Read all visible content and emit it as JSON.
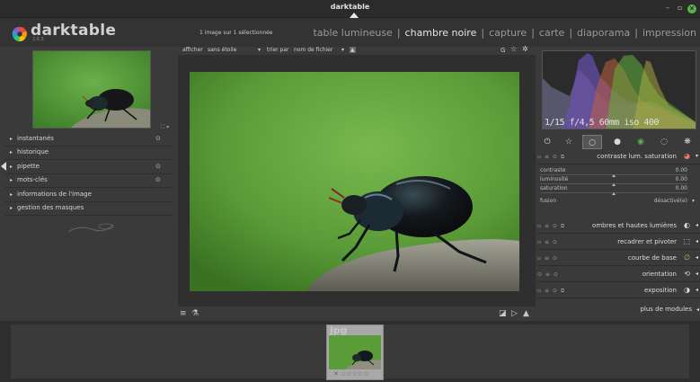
{
  "window": {
    "title": "darktable",
    "minimize": "–",
    "maximize": "▫",
    "close": "✕"
  },
  "header": {
    "app_name": "darktable",
    "version": "2.6.3",
    "selection_count": "1 image sur 1 sélectionnée",
    "views": [
      {
        "label": "table lumineuse",
        "active": false
      },
      {
        "label": "chambre noire",
        "active": true
      },
      {
        "label": "capture",
        "active": false
      },
      {
        "label": "carte",
        "active": false
      },
      {
        "label": "diaporama",
        "active": false
      },
      {
        "label": "impression",
        "active": false
      }
    ]
  },
  "toolbar": {
    "show_label": "afficher",
    "show_value": "sans étoile",
    "sort_label": "trier par",
    "sort_value": "nom de fichier",
    "icons": [
      "grouping-icon",
      "star-icon",
      "gear-icon"
    ]
  },
  "left_panel": {
    "nav_zoom": "⛶ ▾",
    "items": [
      {
        "label": "instantanés",
        "icon": "⊙"
      },
      {
        "label": "historique",
        "icon": ""
      },
      {
        "label": "pipette",
        "icon": "⊙"
      },
      {
        "label": "mots-clés",
        "icon": "⊙"
      },
      {
        "label": "informations de l'image",
        "icon": ""
      },
      {
        "label": "gestion des masques",
        "icon": ""
      }
    ]
  },
  "bottom_toolbar": {
    "left_icons": [
      "≡",
      "⚗"
    ],
    "right_icons": [
      "◪",
      "▷",
      "▲"
    ]
  },
  "right_panel": {
    "histogram_info": "1/15 f/4,5 60mm iso 400",
    "module_groups": [
      "⏻",
      "☆",
      "○",
      "●",
      "◉",
      "◌",
      "❋"
    ],
    "active_group_index": 2,
    "expanded_module": {
      "name": "contraste lum. saturation",
      "sliders": [
        {
          "label": "contraste",
          "value": "0.00"
        },
        {
          "label": "luminosité",
          "value": "0.00"
        },
        {
          "label": "saturation",
          "value": "0.00"
        }
      ],
      "blend_label": "fusion",
      "blend_value": "désactivé(e)"
    },
    "modules": [
      {
        "name": "ombres et hautes lumières",
        "icon": "◐"
      },
      {
        "name": "recadrer et pivoter",
        "icon": "⬚"
      },
      {
        "name": "courbe de base",
        "icon": "∅"
      },
      {
        "name": "orientation",
        "icon": "⟲"
      },
      {
        "name": "exposition",
        "icon": "◑"
      }
    ],
    "more_modules": "plus de modules"
  },
  "filmstrip": {
    "extension": "jpg",
    "stars": "✕ ☆☆☆☆☆"
  },
  "colors": {
    "photo_green": "#5aa03a",
    "panel_bg": "#3a3a3a",
    "accent_close": "#5cb34e"
  }
}
